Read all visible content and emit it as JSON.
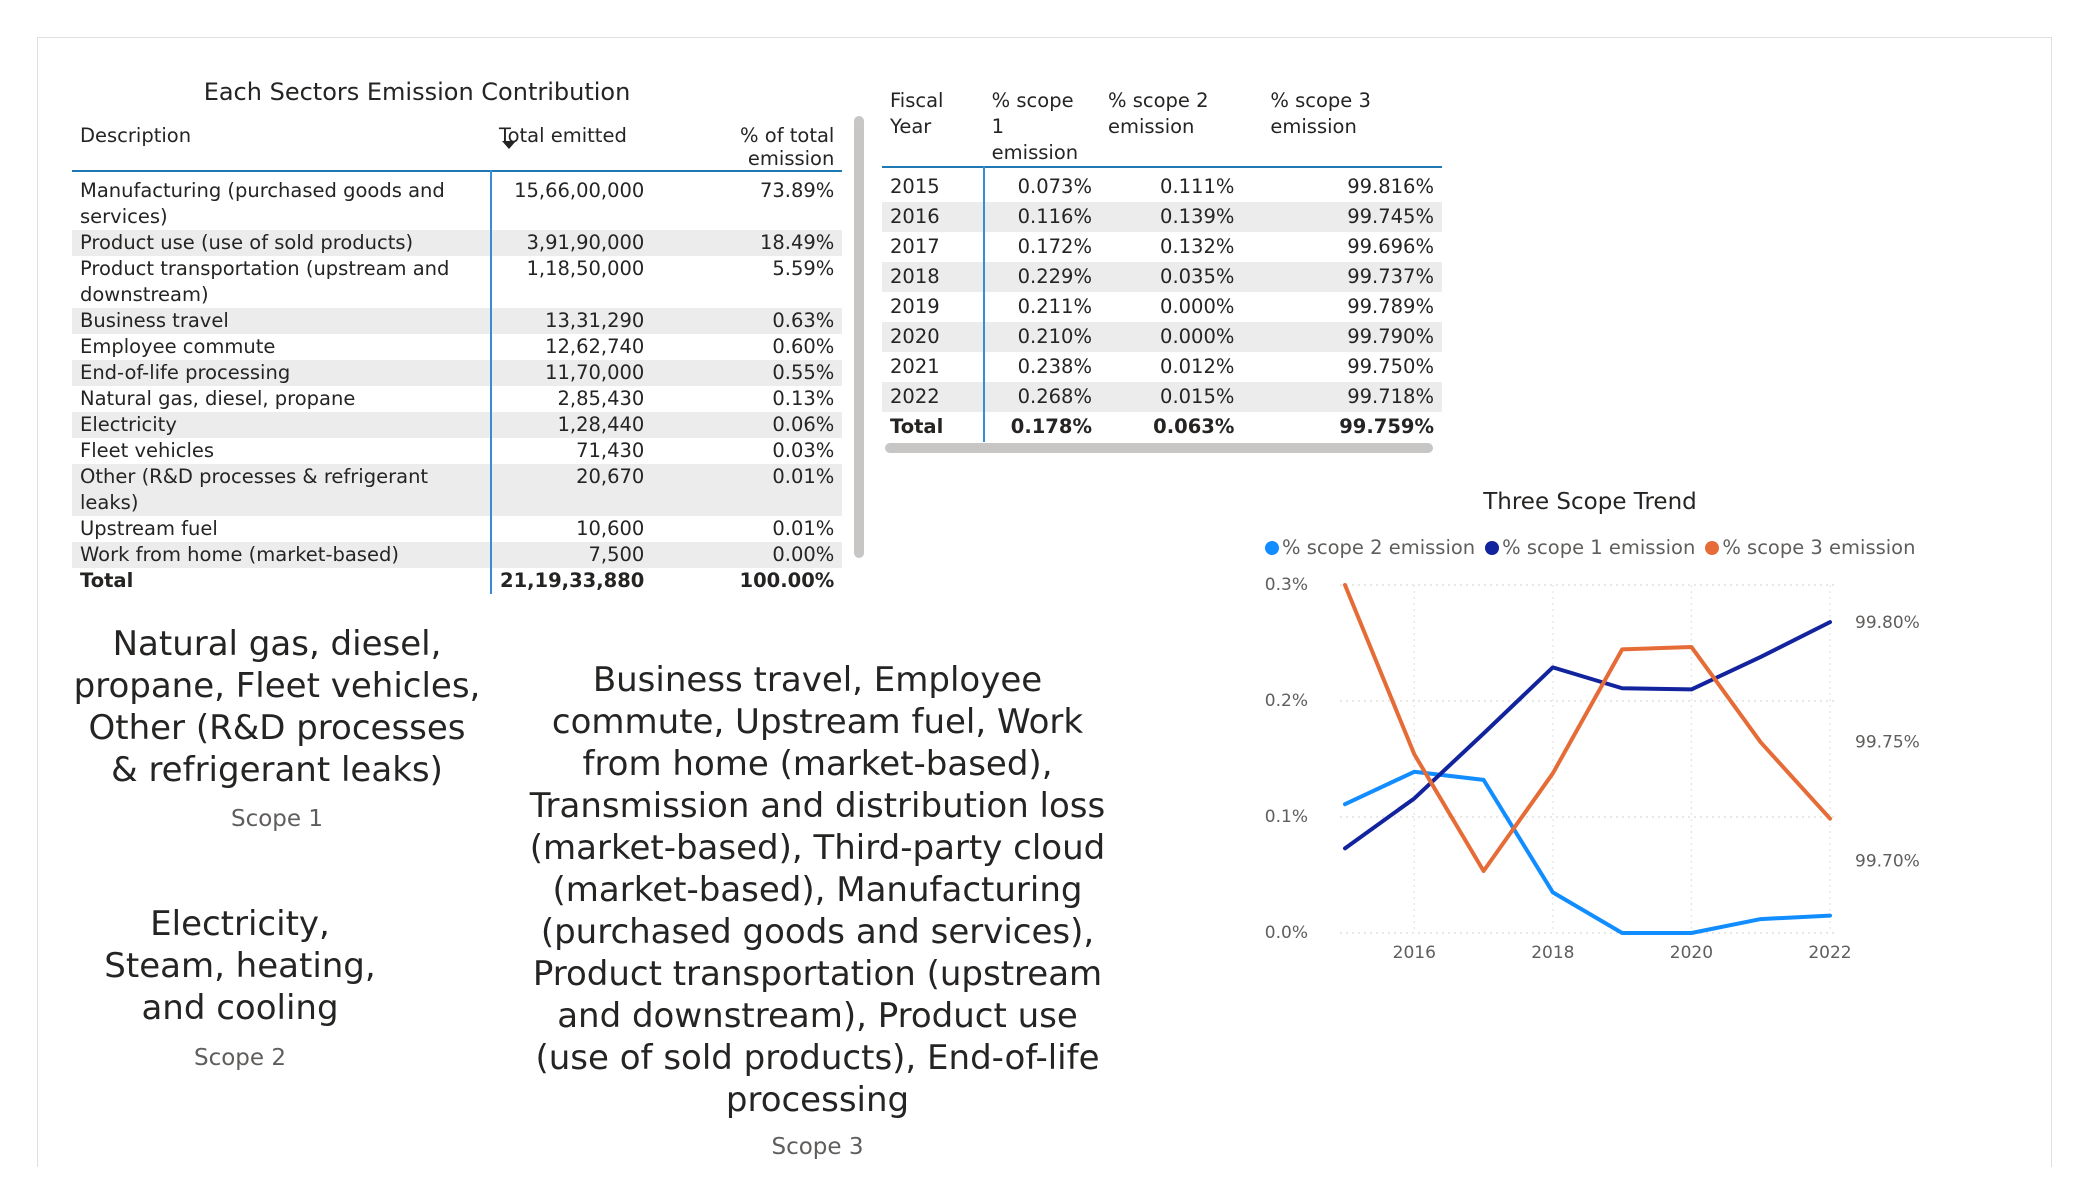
{
  "sector_table": {
    "title": "Each Sectors Emission Contribution",
    "columns": [
      "Description",
      "Total emitted",
      "% of total emission"
    ],
    "rows": [
      [
        "Manufacturing (purchased goods and services)",
        "15,66,00,000",
        "73.89%"
      ],
      [
        "Product use (use of sold products)",
        "3,91,90,000",
        "18.49%"
      ],
      [
        "Product transportation (upstream and downstream)",
        "1,18,50,000",
        "5.59%"
      ],
      [
        "Business travel",
        "13,31,290",
        "0.63%"
      ],
      [
        "Employee commute",
        "12,62,740",
        "0.60%"
      ],
      [
        "End-of-life processing",
        "11,70,000",
        "0.55%"
      ],
      [
        "Natural gas, diesel, propane",
        "2,85,430",
        "0.13%"
      ],
      [
        "Electricity",
        "1,28,440",
        "0.06%"
      ],
      [
        "Fleet vehicles",
        "71,430",
        "0.03%"
      ],
      [
        "Other (R&D processes & refrigerant leaks)",
        "20,670",
        "0.01%"
      ],
      [
        "Upstream fuel",
        "10,600",
        "0.01%"
      ],
      [
        "Work from home (market-based)",
        "7,500",
        "0.00%"
      ]
    ],
    "total": [
      "Total",
      "21,19,33,880",
      "100.00%"
    ]
  },
  "fiscal_table": {
    "columns": [
      "Fiscal Year",
      "% scope 1 emission",
      "% scope 2 emission",
      "% scope 3 emission"
    ],
    "rows": [
      [
        "2015",
        "0.073%",
        "0.111%",
        "99.816%"
      ],
      [
        "2016",
        "0.116%",
        "0.139%",
        "99.745%"
      ],
      [
        "2017",
        "0.172%",
        "0.132%",
        "99.696%"
      ],
      [
        "2018",
        "0.229%",
        "0.035%",
        "99.737%"
      ],
      [
        "2019",
        "0.211%",
        "0.000%",
        "99.789%"
      ],
      [
        "2020",
        "0.210%",
        "0.000%",
        "99.790%"
      ],
      [
        "2021",
        "0.238%",
        "0.012%",
        "99.750%"
      ],
      [
        "2022",
        "0.268%",
        "0.015%",
        "99.718%"
      ]
    ],
    "total": [
      "Total",
      "0.178%",
      "0.063%",
      "99.759%"
    ]
  },
  "cards": {
    "scope1": {
      "text": "Natural gas, diesel, propane, Fleet vehicles, Other (R&D processes & refrigerant leaks)",
      "label": "Scope 1"
    },
    "scope2": {
      "text": "Electricity, Steam, heating, and cooling",
      "label": "Scope 2"
    },
    "scope3": {
      "text": "Business travel, Employee commute, Upstream fuel, Work from home (market-based), Transmission and distribution loss (market-based), Third-party cloud (market-based), Manufacturing (purchased goods and services), Product transportation (upstream and downstream), Product use (use of sold products), End-of-life processing",
      "label": "Scope 3"
    }
  },
  "chart_data": {
    "type": "line",
    "title": "Three Scope Trend",
    "x": [
      2015,
      2016,
      2017,
      2018,
      2019,
      2020,
      2021,
      2022
    ],
    "x_ticks": [
      "2016",
      "2018",
      "2020",
      "2022"
    ],
    "y_left_ticks": [
      "0.0%",
      "0.1%",
      "0.2%",
      "0.3%"
    ],
    "y_left_range": [
      0,
      0.3
    ],
    "y_right_ticks": [
      "99.70%",
      "99.75%",
      "99.80%"
    ],
    "y_right_range": [
      99.67,
      99.816
    ],
    "legend_position": "top",
    "grid": true,
    "series": [
      {
        "name": "% scope 2 emission",
        "axis": "left",
        "color": "#118dff",
        "values": [
          0.111,
          0.139,
          0.132,
          0.035,
          0.0,
          0.0,
          0.012,
          0.015
        ]
      },
      {
        "name": "% scope 1 emission",
        "axis": "left",
        "color": "#12239e",
        "values": [
          0.073,
          0.116,
          0.172,
          0.229,
          0.211,
          0.21,
          0.238,
          0.268
        ]
      },
      {
        "name": "% scope 3 emission",
        "axis": "right",
        "color": "#e66c37",
        "values": [
          99.816,
          99.745,
          99.696,
          99.737,
          99.789,
          99.79,
          99.75,
          99.718
        ]
      }
    ]
  }
}
